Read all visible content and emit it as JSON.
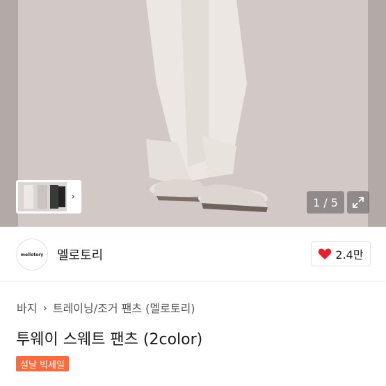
{
  "gallery": {
    "pager_text": "1 / 5",
    "thumb_arrow": "›",
    "expand_icon": "expand-icon"
  },
  "store": {
    "logo_text": "mellotory",
    "name": "멜로토리",
    "like_count": "2.4만",
    "like_icon": "heart-icon",
    "heart_color": "#e8202b"
  },
  "breadcrumb": {
    "category": "바지",
    "separator": "›",
    "subcategory": "트레이닝/조거 팬츠 (멜로토리)"
  },
  "product": {
    "title": "투웨이 스웨트 팬츠 (2color)",
    "badge": "설날 빅세일",
    "badge_color": "#ff6a3d"
  }
}
